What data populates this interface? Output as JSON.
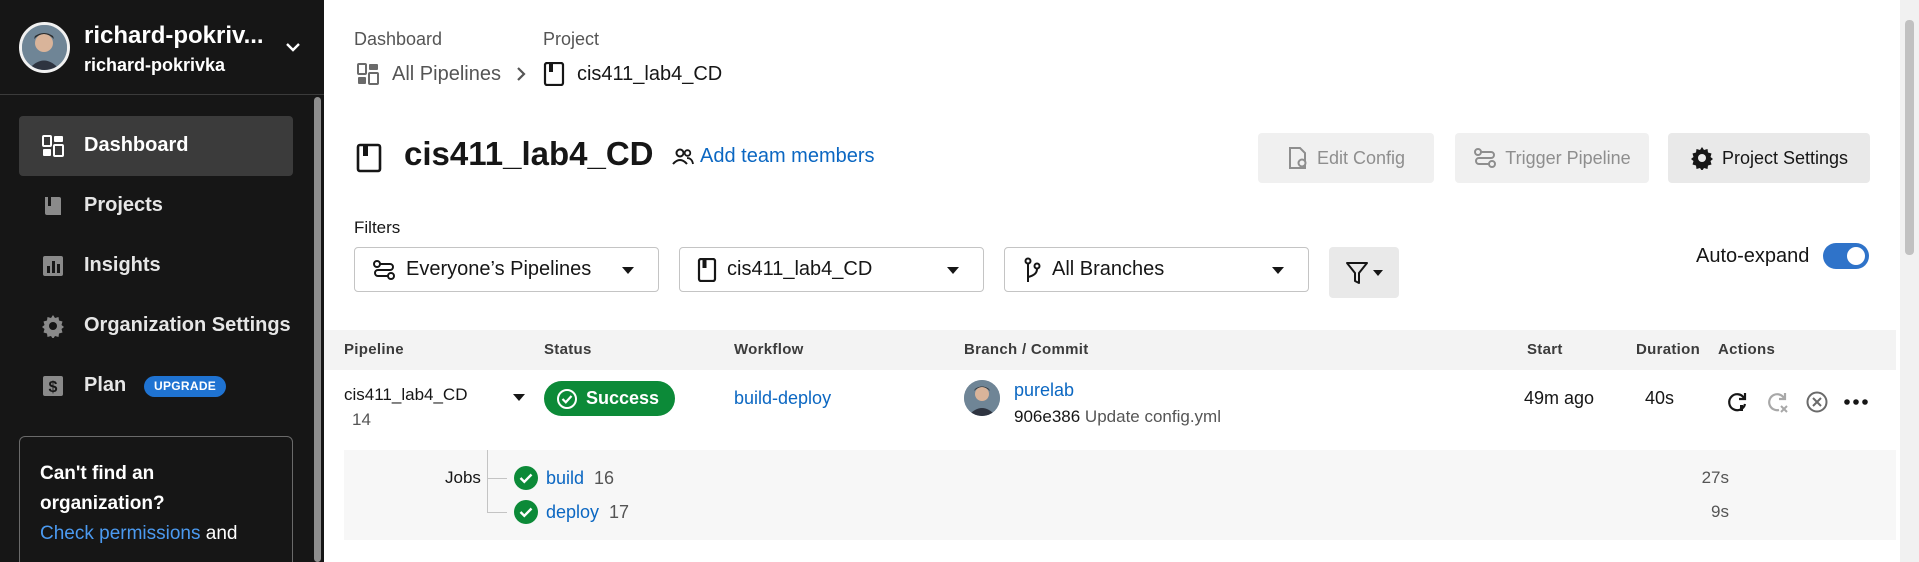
{
  "sidebar": {
    "org": {
      "name": "richard-pokrivka",
      "display_name": "richard-pokriv...",
      "subtitle": "richard-pokrivka"
    },
    "items": [
      {
        "label": "Dashboard",
        "icon": "dashboard-icon",
        "active": true
      },
      {
        "label": "Projects",
        "icon": "projects-icon",
        "active": false
      },
      {
        "label": "Insights",
        "icon": "insights-icon",
        "active": false
      },
      {
        "label": "Organization Settings",
        "icon": "gear-icon",
        "active": false
      },
      {
        "label": "Plan",
        "icon": "dollar-icon",
        "active": false,
        "badge": "UPGRADE"
      }
    ],
    "notice": {
      "heading": "Can't find an organization?",
      "link": "Check permissions",
      "tail": "and"
    }
  },
  "breadcrumb": {
    "dashboard_label": "Dashboard",
    "project_label": "Project",
    "all_pipelines": "All Pipelines",
    "project_name": "cis411_lab4_CD"
  },
  "header": {
    "title": "cis411_lab4_CD",
    "add_team": "Add team members",
    "edit_config": "Edit Config",
    "trigger_pipeline": "Trigger Pipeline",
    "project_settings": "Project Settings"
  },
  "filters": {
    "label": "Filters",
    "pipelines": "Everyone’s Pipelines",
    "project": "cis411_lab4_CD",
    "branches": "All Branches",
    "auto_expand": "Auto-expand",
    "auto_expand_on": true
  },
  "table": {
    "headers": [
      "Pipeline",
      "Status",
      "Workflow",
      "Branch / Commit",
      "Start",
      "Duration",
      "Actions"
    ],
    "row": {
      "pipeline": "cis411_lab4_CD",
      "number": "14",
      "status": "Success",
      "workflow": "build-deploy",
      "author": "purelab",
      "commit_sha": "906e386",
      "commit_msg": "Update config.yml",
      "start": "49m ago",
      "duration": "40s"
    },
    "jobs": {
      "label": "Jobs",
      "items": [
        {
          "name": "build",
          "number": "16",
          "duration": "27s"
        },
        {
          "name": "deploy",
          "number": "17",
          "duration": "9s"
        }
      ]
    }
  },
  "colors": {
    "success": "#0c8a38",
    "link": "#0b67c2",
    "sidebar": "#161616",
    "toggle": "#2f73c9",
    "badge": "#1f73d2"
  }
}
